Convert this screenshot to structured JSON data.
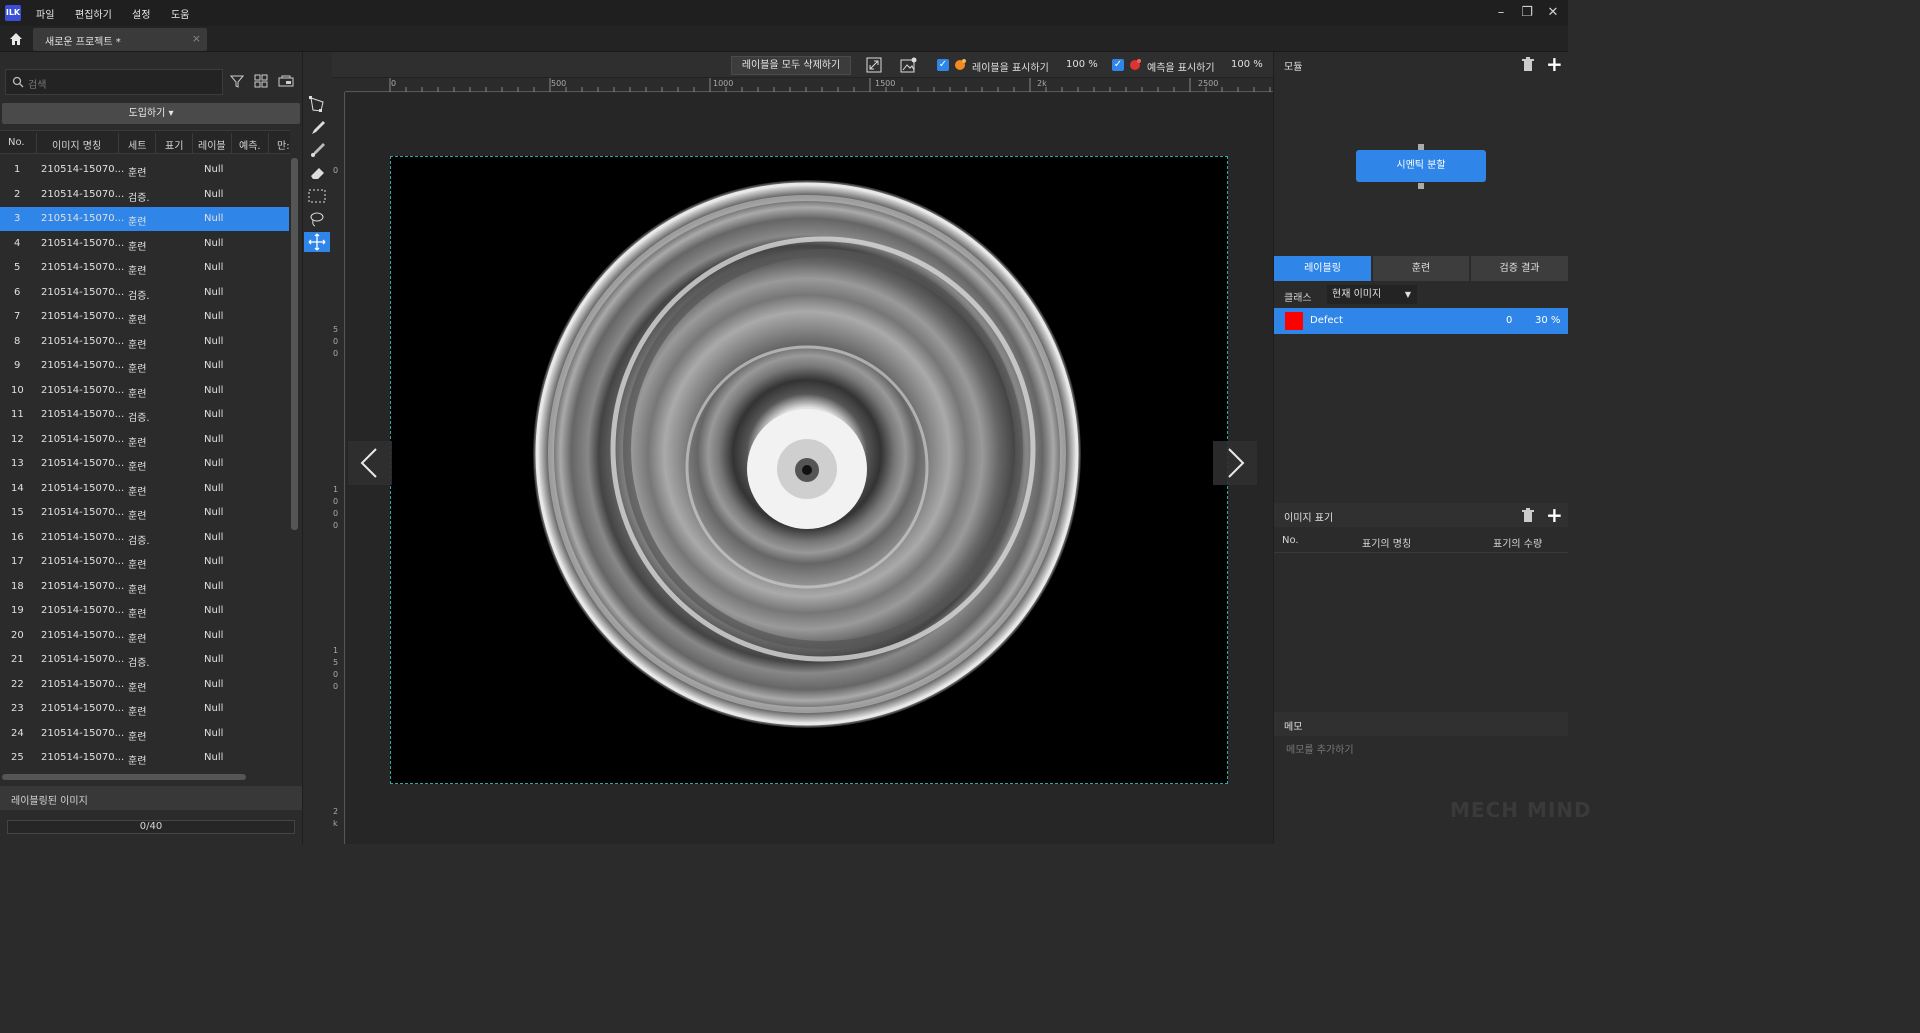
{
  "app": {
    "logo_text": "ILK"
  },
  "menu": [
    "파일",
    "편집하기",
    "설정",
    "도움"
  ],
  "project_tab": {
    "title": "새로운 프로젝트 *",
    "close": "×"
  },
  "left_panel": {
    "search_placeholder": "검색",
    "import_button": "도입하기 ▾",
    "columns": [
      "No.",
      "이미지 명칭",
      "세트",
      "표기",
      "레이블",
      "예측.",
      "만:"
    ],
    "rows": [
      {
        "no": "1",
        "name": "210514-15070...",
        "set": "훈련",
        "label": "Null"
      },
      {
        "no": "2",
        "name": "210514-15070...",
        "set": "검증.",
        "label": "Null"
      },
      {
        "no": "3",
        "name": "210514-15070...",
        "set": "훈련",
        "label": "Null",
        "selected": true
      },
      {
        "no": "4",
        "name": "210514-15070...",
        "set": "훈련",
        "label": "Null"
      },
      {
        "no": "5",
        "name": "210514-15070...",
        "set": "훈련",
        "label": "Null"
      },
      {
        "no": "6",
        "name": "210514-15070...",
        "set": "검증.",
        "label": "Null"
      },
      {
        "no": "7",
        "name": "210514-15070...",
        "set": "훈련",
        "label": "Null"
      },
      {
        "no": "8",
        "name": "210514-15070...",
        "set": "훈련",
        "label": "Null"
      },
      {
        "no": "9",
        "name": "210514-15070...",
        "set": "훈련",
        "label": "Null"
      },
      {
        "no": "10",
        "name": "210514-15070...",
        "set": "훈련",
        "label": "Null"
      },
      {
        "no": "11",
        "name": "210514-15070...",
        "set": "검증.",
        "label": "Null"
      },
      {
        "no": "12",
        "name": "210514-15070...",
        "set": "훈련",
        "label": "Null"
      },
      {
        "no": "13",
        "name": "210514-15070...",
        "set": "훈련",
        "label": "Null"
      },
      {
        "no": "14",
        "name": "210514-15070...",
        "set": "훈련",
        "label": "Null"
      },
      {
        "no": "15",
        "name": "210514-15070...",
        "set": "훈련",
        "label": "Null"
      },
      {
        "no": "16",
        "name": "210514-15070...",
        "set": "검증.",
        "label": "Null"
      },
      {
        "no": "17",
        "name": "210514-15070...",
        "set": "훈련",
        "label": "Null"
      },
      {
        "no": "18",
        "name": "210514-15070...",
        "set": "훈련",
        "label": "Null"
      },
      {
        "no": "19",
        "name": "210514-15070...",
        "set": "훈련",
        "label": "Null"
      },
      {
        "no": "20",
        "name": "210514-15070...",
        "set": "훈련",
        "label": "Null"
      },
      {
        "no": "21",
        "name": "210514-15070...",
        "set": "검증.",
        "label": "Null"
      },
      {
        "no": "22",
        "name": "210514-15070...",
        "set": "훈련",
        "label": "Null"
      },
      {
        "no": "23",
        "name": "210514-15070...",
        "set": "훈련",
        "label": "Null"
      },
      {
        "no": "24",
        "name": "210514-15070...",
        "set": "훈련",
        "label": "Null"
      },
      {
        "no": "25",
        "name": "210514-15070...",
        "set": "훈련",
        "label": "Null"
      }
    ],
    "labeled_images": "레이블링된 이미지",
    "progress": "0/40"
  },
  "toolbar": {
    "clear_labels": "레이블을 모두 삭제하기",
    "show_labels": "레이블을 표시하기",
    "label_opacity": "100 %",
    "show_predictions": "예측을 표시하기",
    "prediction_opacity": "100 %"
  },
  "ruler_marks": [
    "0",
    "500",
    "1000",
    "1500",
    "2k",
    "2500"
  ],
  "vruler_marks": [
    "0",
    "5\n0\n0",
    "1\n0\n0\n0",
    "1\n5\n0\n0",
    "2\nk"
  ],
  "right_panel": {
    "module_title": "모듈",
    "module_box": "시멘틱 분할",
    "tabs": [
      "레이블링",
      "훈련",
      "검증 결과"
    ],
    "class_label": "클래스",
    "class_select": "현재 이미지",
    "classes": [
      {
        "name": "Defect",
        "count": "0",
        "percent": "30 %",
        "color": "#ff0000"
      }
    ],
    "image_tags_title": "이미지 표기",
    "tags_columns": [
      "No.",
      "표기의 명칭",
      "표기의 수량"
    ],
    "memo_title": "메모",
    "memo_placeholder": "메모를 추가하기"
  },
  "watermark": "MECH MIND"
}
